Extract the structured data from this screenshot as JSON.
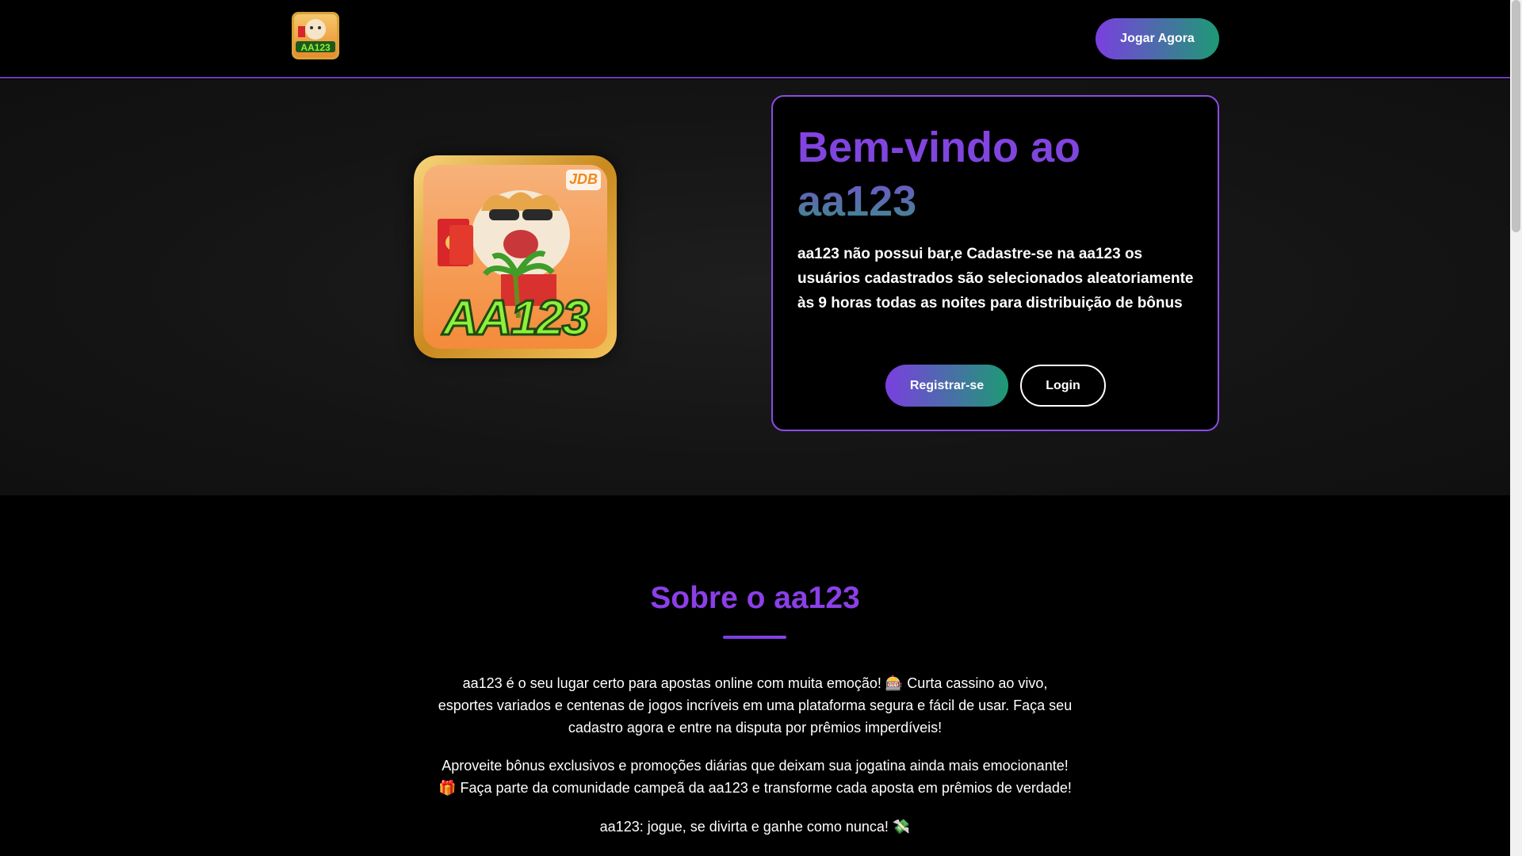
{
  "header": {
    "logo_text": "AA123",
    "cta_label": "Jogar Agora"
  },
  "hero": {
    "logo_text": "AA123",
    "logo_badge": "JDB",
    "title_line1": "Bem-vindo ao",
    "title_line2": "aa123",
    "description": "aa123 não possui bar,e Cadastre-se na aa123 os usuários cadastrados são selecionados aleatoriamente às 9 horas todas as noites para distribuição de bônus",
    "register_label": "Registrar-se",
    "login_label": "Login"
  },
  "about": {
    "title": "Sobre o aa123",
    "paragraphs": [
      "aa123 é o seu lugar certo para apostas online com muita emoção! 🎰 Curta cassino ao vivo, esportes variados e centenas de jogos incríveis em uma plataforma segura e fácil de usar. Faça seu cadastro agora e entre na disputa por prêmios imperdíveis!",
      "Aproveite bônus exclusivos e promoções diárias que deixam sua jogatina ainda mais emocionante! 🎁 Faça parte da comunidade campeã da aa123 e transforme cada aposta em prêmios de verdade!",
      "aa123: jogue, se divirta e ganhe como nunca! 💸"
    ]
  },
  "colors": {
    "accent_purple": "#8b3fe8",
    "accent_green": "#1d9a74",
    "background": "#000000"
  }
}
